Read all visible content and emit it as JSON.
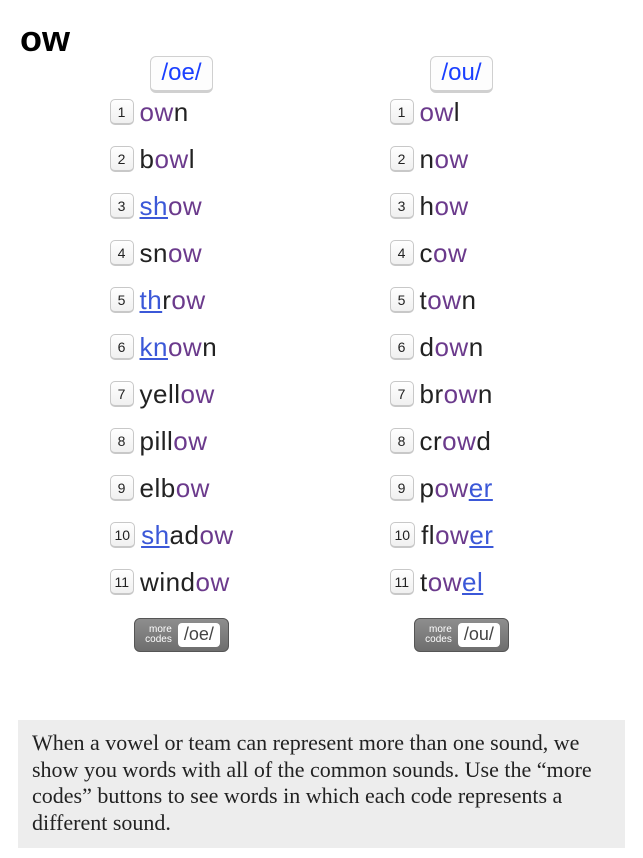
{
  "title": "ow",
  "columns": [
    {
      "phoneme": "/oe/",
      "more_label": "more\ncodes",
      "more_phoneme": "/oe/",
      "words": [
        {
          "n": "1",
          "segs": [
            {
              "t": "ow",
              "c": "purple"
            },
            {
              "t": "n",
              "c": "black"
            }
          ]
        },
        {
          "n": "2",
          "segs": [
            {
              "t": "b",
              "c": "black"
            },
            {
              "t": "ow",
              "c": "purple"
            },
            {
              "t": "l",
              "c": "black"
            }
          ]
        },
        {
          "n": "3",
          "segs": [
            {
              "t": "sh",
              "c": "link"
            },
            {
              "t": "ow",
              "c": "purple"
            }
          ]
        },
        {
          "n": "4",
          "segs": [
            {
              "t": "sn",
              "c": "black"
            },
            {
              "t": "ow",
              "c": "purple"
            }
          ]
        },
        {
          "n": "5",
          "segs": [
            {
              "t": "th",
              "c": "link"
            },
            {
              "t": "r",
              "c": "black"
            },
            {
              "t": "ow",
              "c": "purple"
            }
          ]
        },
        {
          "n": "6",
          "segs": [
            {
              "t": "kn",
              "c": "link"
            },
            {
              "t": "ow",
              "c": "purple"
            },
            {
              "t": "n",
              "c": "black"
            }
          ]
        },
        {
          "n": "7",
          "segs": [
            {
              "t": "yell",
              "c": "black"
            },
            {
              "t": "ow",
              "c": "purple"
            }
          ]
        },
        {
          "n": "8",
          "segs": [
            {
              "t": "pill",
              "c": "black"
            },
            {
              "t": "ow",
              "c": "purple"
            }
          ]
        },
        {
          "n": "9",
          "segs": [
            {
              "t": "elb",
              "c": "black"
            },
            {
              "t": "ow",
              "c": "purple"
            }
          ]
        },
        {
          "n": "10",
          "segs": [
            {
              "t": "sh",
              "c": "link"
            },
            {
              "t": "ad",
              "c": "black"
            },
            {
              "t": "ow",
              "c": "purple"
            }
          ]
        },
        {
          "n": "11",
          "segs": [
            {
              "t": "wind",
              "c": "black"
            },
            {
              "t": "ow",
              "c": "purple"
            }
          ]
        }
      ]
    },
    {
      "phoneme": "/ou/",
      "more_label": "more\ncodes",
      "more_phoneme": "/ou/",
      "words": [
        {
          "n": "1",
          "segs": [
            {
              "t": "ow",
              "c": "purple"
            },
            {
              "t": "l",
              "c": "black"
            }
          ]
        },
        {
          "n": "2",
          "segs": [
            {
              "t": "n",
              "c": "black"
            },
            {
              "t": "ow",
              "c": "purple"
            }
          ]
        },
        {
          "n": "3",
          "segs": [
            {
              "t": "h",
              "c": "black"
            },
            {
              "t": "ow",
              "c": "purple"
            }
          ]
        },
        {
          "n": "4",
          "segs": [
            {
              "t": "c",
              "c": "black"
            },
            {
              "t": "ow",
              "c": "purple"
            }
          ]
        },
        {
          "n": "5",
          "segs": [
            {
              "t": "t",
              "c": "black"
            },
            {
              "t": "ow",
              "c": "purple"
            },
            {
              "t": "n",
              "c": "black"
            }
          ]
        },
        {
          "n": "6",
          "segs": [
            {
              "t": "d",
              "c": "black"
            },
            {
              "t": "ow",
              "c": "purple"
            },
            {
              "t": "n",
              "c": "black"
            }
          ]
        },
        {
          "n": "7",
          "segs": [
            {
              "t": "br",
              "c": "black"
            },
            {
              "t": "ow",
              "c": "purple"
            },
            {
              "t": "n",
              "c": "black"
            }
          ]
        },
        {
          "n": "8",
          "segs": [
            {
              "t": "cr",
              "c": "black"
            },
            {
              "t": "ow",
              "c": "purple"
            },
            {
              "t": "d",
              "c": "black"
            }
          ]
        },
        {
          "n": "9",
          "segs": [
            {
              "t": "p",
              "c": "black"
            },
            {
              "t": "ow",
              "c": "purple"
            },
            {
              "t": "er",
              "c": "link"
            }
          ]
        },
        {
          "n": "10",
          "segs": [
            {
              "t": "fl",
              "c": "black"
            },
            {
              "t": "ow",
              "c": "purple"
            },
            {
              "t": "er",
              "c": "link"
            }
          ]
        },
        {
          "n": "11",
          "segs": [
            {
              "t": "t",
              "c": "black"
            },
            {
              "t": "ow",
              "c": "purple"
            },
            {
              "t": "el",
              "c": "link"
            }
          ]
        }
      ]
    }
  ],
  "footer": "When a vowel or team can represent more than one sound, we show you words with all of the common sounds. Use the “more codes” buttons to see words in which each code represents a different sound."
}
